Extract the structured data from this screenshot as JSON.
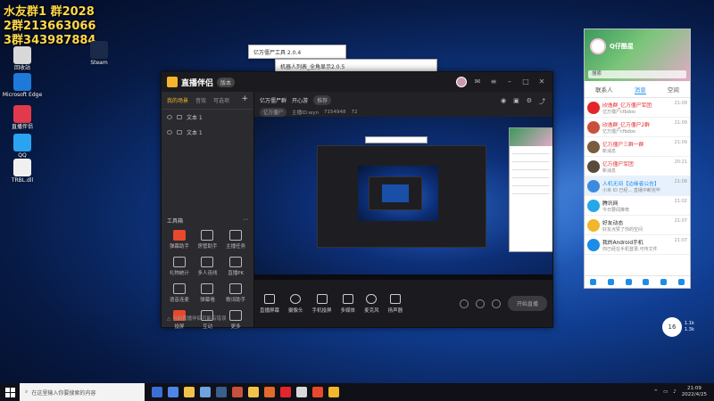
{
  "overlay_lines": [
    "水友群1 群2028",
    "2群213663066",
    "3群343987884"
  ],
  "desktop_icons": [
    {
      "label": "回收站",
      "color": "#d8d8d8"
    },
    {
      "label": "Microsoft Edge",
      "color": "#1d7ad8"
    },
    {
      "label": "Steam",
      "color": "#1a2a48"
    },
    {
      "label": "直播伴侣",
      "color": "#e23a4a"
    },
    {
      "label": "QQ",
      "color": "#2aa4f0"
    },
    {
      "label": "TRBL.dll",
      "color": "#f0f0f0"
    }
  ],
  "app": {
    "title": "直播伴侣",
    "version": "版本",
    "left_tabs": [
      "我的场景",
      "音效",
      "可选项"
    ],
    "layers": [
      "文本 1",
      "文本 1"
    ],
    "toolbox_title": "工具箱",
    "tools": [
      "弹幕助手",
      "房管助手",
      "主播任务",
      "礼物统计",
      "多人连线",
      "直播PK",
      "语音连麦",
      "弹幕墙",
      "歌词助手",
      "投屏",
      "互动",
      "更多"
    ],
    "tip": "△ 当前直播伴侣可能有错误",
    "scene_name": "亿万僵尸群",
    "scene_sub": "开心游",
    "scene_pill": "推荐",
    "stage_meta": [
      "亿万僵尸",
      "主播ID:wyn",
      "7154948",
      "72"
    ],
    "bottom_items": [
      "直播屏幕",
      "摄像头",
      "手机投屏",
      "多媒体",
      "麦克风",
      "扬声器"
    ],
    "start_label": "开始直播"
  },
  "dialogs": [
    {
      "title": "亿万僵尸工具 2.0.4"
    },
    {
      "title": "机器人列表_全角显示2.0.5"
    }
  ],
  "chat": {
    "user": "Q仔酷星",
    "search_placeholder": "搜索",
    "tabs": [
      "联系人",
      "消息",
      "空间"
    ],
    "active_tab": "消息",
    "items": [
      {
        "name": "欣逸群_亿万僵尸军团",
        "msg": "亿万僵尸cfbdoo",
        "time": "21:09",
        "style": "red",
        "avatar": "#e2262b"
      },
      {
        "name": "欣逸群_亿万僵尸2群",
        "msg": "亿万僵尸cfbdoo",
        "time": "21:09",
        "style": "red",
        "avatar": "#c9503d"
      },
      {
        "name": "亿万僵尸三群一群",
        "msg": "新消息",
        "time": "21:09",
        "style": "red",
        "avatar": "#7a5b3d"
      },
      {
        "name": "亿万僵尸军团",
        "msg": "新消息",
        "time": "20:21",
        "style": "red",
        "avatar": "#5a4a3a"
      },
      {
        "name": "人机无间【边缘者公告】",
        "msg": "小米 ID 已经... 直播中断完毕",
        "time": "21:08",
        "style": "blue",
        "avatar": "#3d8be0"
      },
      {
        "name": "腾讯网",
        "msg": "今日要闻推荐",
        "time": "21:02",
        "style": "normal",
        "avatar": "#26a7e8"
      },
      {
        "name": "好友动态",
        "msg": "好友点赞了你的空间",
        "time": "21:07",
        "style": "normal",
        "avatar": "#f2b52b"
      },
      {
        "name": "我的Android手机",
        "msg": "你已经在手机登录,可传文件",
        "time": "21:07",
        "style": "normal",
        "avatar": "#1d8ce8"
      }
    ]
  },
  "speed": {
    "value": "16",
    "up": "1.1k",
    "down": "1.3k"
  },
  "taskbar": {
    "search_placeholder": "在这里输入你要搜索的内容",
    "time": "21:09",
    "date": "2022/4/25",
    "app_colors": [
      "#3a6fd8",
      "#4d86e8",
      "#f2c24b",
      "#6fa3e0",
      "#3a5f8a",
      "#c9503d",
      "#f2c24b",
      "#e26a2a",
      "#e2262b",
      "#d8d8d8",
      "#e8492c",
      "#f2b52b"
    ]
  }
}
